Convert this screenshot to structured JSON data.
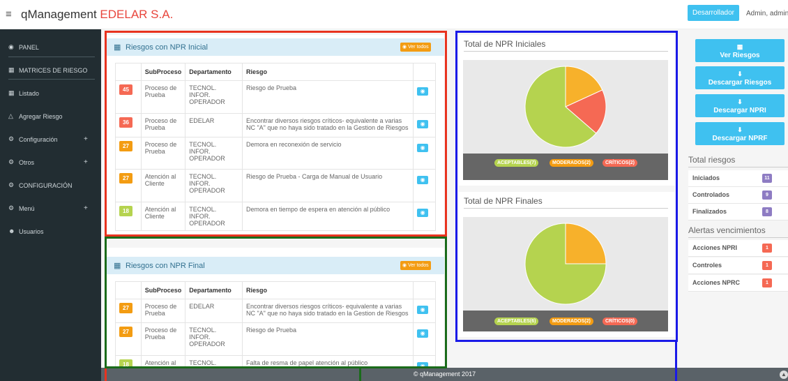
{
  "header": {
    "menu_icon": "hamburger-icon",
    "brand": "qManagement",
    "company": "EDELAR S.A.",
    "dev_button": "Desarrollador",
    "user": "Admin, admin"
  },
  "sidebar": {
    "items": [
      {
        "icon": "dashboard-icon",
        "label": "PANEL"
      },
      {
        "icon": "grid-icon",
        "label": "MATRICES DE RIESGO"
      },
      {
        "icon": "table-icon",
        "label": "Listado"
      },
      {
        "icon": "add-icon",
        "label": "Agregar Riesgo"
      },
      {
        "icon": "cogs-icon",
        "label": "Configuración",
        "expand": "+"
      },
      {
        "icon": "cogs-icon",
        "label": "Otros",
        "expand": "+"
      },
      {
        "icon": "cogs-icon",
        "label": "CONFIGURACIÓN"
      },
      {
        "icon": "cogs-icon",
        "label": "Menú",
        "expand": "+"
      },
      {
        "icon": "users-icon",
        "label": "Usuarios"
      }
    ]
  },
  "npr_inicial": {
    "title": "Riesgos con NPR Inicial",
    "ver_todos": "Ver todos",
    "columns": [
      "",
      "SubProceso",
      "Departamento",
      "Riesgo",
      ""
    ],
    "rows": [
      {
        "score": "45",
        "level": "red",
        "subproceso": "Proceso de Prueba",
        "departamento": "TECNOL. INFOR. OPERADOR",
        "riesgo": "Riesgo de Prueba"
      },
      {
        "score": "36",
        "level": "red",
        "subproceso": "Proceso de Prueba",
        "departamento": "EDELAR",
        "riesgo": "Encontrar diversos riesgos críticos- equivalente a varias NC \"A\" que no haya sido tratado en la Gestion de Riesgos"
      },
      {
        "score": "27",
        "level": "orange",
        "subproceso": "Proceso de Prueba",
        "departamento": "TECNOL. INFOR. OPERADOR",
        "riesgo": "Demora en reconexión de servicio"
      },
      {
        "score": "27",
        "level": "orange",
        "subproceso": "Atención al Cliente",
        "departamento": "TECNOL. INFOR. OPERADOR",
        "riesgo": "Riesgo de Prueba - Carga de Manual de Usuario"
      },
      {
        "score": "18",
        "level": "green",
        "subproceso": "Atención al Cliente",
        "departamento": "TECNOL. INFOR. OPERADOR",
        "riesgo": "Demora en tiempo de espera en atención al público"
      }
    ]
  },
  "npr_final": {
    "title": "Riesgos con NPR Final",
    "ver_todos": "Ver todos",
    "columns": [
      "",
      "SubProceso",
      "Departamento",
      "Riesgo",
      ""
    ],
    "rows": [
      {
        "score": "27",
        "level": "orange",
        "subproceso": "Proceso de Prueba",
        "departamento": "EDELAR",
        "riesgo": "Encontrar diversos riesgos críticos- equivalente a varias NC \"A\" que no haya sido tratado en la Gestion de Riesgos"
      },
      {
        "score": "27",
        "level": "orange",
        "subproceso": "Proceso de Prueba",
        "departamento": "TECNOL. INFOR. OPERADOR",
        "riesgo": "Riesgo de Prueba"
      },
      {
        "score": "18",
        "level": "green",
        "subproceso": "Atención al",
        "departamento": "TECNOL.",
        "riesgo": "Falta de resma de papel atención al público"
      }
    ]
  },
  "charts": {
    "iniciales_title": "Total de NPR Iniciales",
    "finales_title": "Total de NPR Finales",
    "iniciales_legend": [
      "ACEPTABLES(7)",
      "MODERADOS(2)",
      "CRÍTICOS(2)"
    ],
    "finales_legend": [
      "ACEPTABLES(6)",
      "MODERADOS(2)",
      "CRÍTICOS(0)"
    ]
  },
  "chart_data": [
    {
      "type": "pie",
      "title": "Total de NPR Iniciales",
      "categories": [
        "ACEPTABLES",
        "MODERADOS",
        "CRÍTICOS"
      ],
      "values": [
        7,
        2,
        2
      ],
      "colors": [
        "#b5d34f",
        "#f7b12b",
        "#f56954"
      ]
    },
    {
      "type": "pie",
      "title": "Total de NPR Finales",
      "categories": [
        "ACEPTABLES",
        "MODERADOS",
        "CRÍTICOS"
      ],
      "values": [
        6,
        2,
        0
      ],
      "colors": [
        "#b5d34f",
        "#f7b12b",
        "#f56954"
      ]
    }
  ],
  "right": {
    "buttons": [
      {
        "icon": "table-icon",
        "label": "Ver Riesgos"
      },
      {
        "icon": "download-icon",
        "label": "Descargar Riesgos"
      },
      {
        "icon": "download-icon",
        "label": "Descargar NPRI"
      },
      {
        "icon": "download-icon",
        "label": "Descargar NPRF"
      }
    ],
    "total_title": "Total riesgos",
    "totals": [
      {
        "label": "Iniciados",
        "value": "11"
      },
      {
        "label": "Controlados",
        "value": "9"
      },
      {
        "label": "Finalizados",
        "value": "8"
      }
    ],
    "alertas_title": "Alertas vencimientos",
    "alertas": [
      {
        "label": "Acciones NPRI",
        "value": "1"
      },
      {
        "label": "Controles",
        "value": "1"
      },
      {
        "label": "Acciones NPRC",
        "value": "1"
      }
    ]
  },
  "footer": {
    "text": "© qManagement 2017"
  },
  "colors": {
    "red": "#f56954",
    "orange": "#f39c12",
    "green": "#b5d34f",
    "info": "#3fc1f0",
    "sidebar": "#222d32"
  }
}
